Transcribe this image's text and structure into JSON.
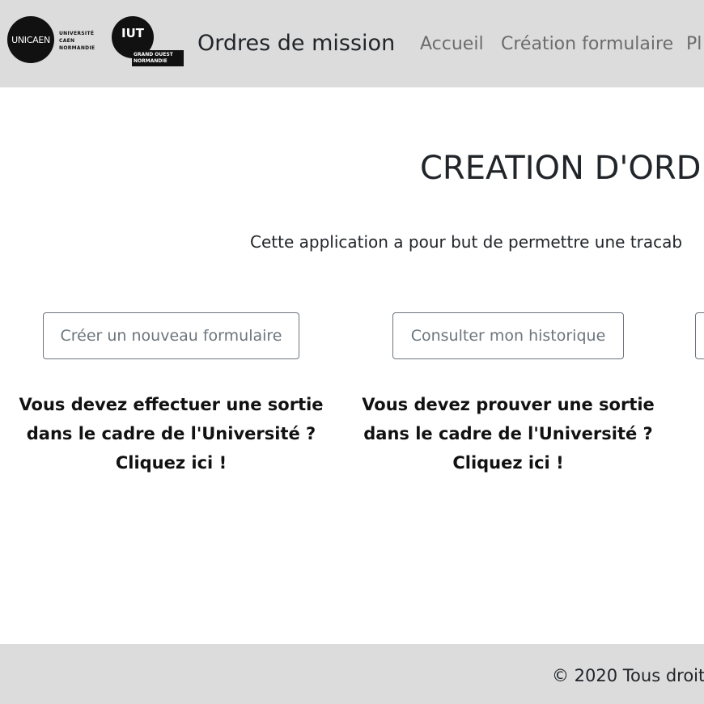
{
  "header": {
    "logos": {
      "unicaen_mark": "UNICAEN",
      "unicaen_text": [
        "UNIVERSITÉ",
        "CAEN",
        "NORMANDIE"
      ],
      "iut_mark": "IUT",
      "iut_text": [
        "GRAND OUEST",
        "NORMANDIE"
      ]
    },
    "brand": "Ordres de mission",
    "nav": [
      {
        "label": "Accueil"
      },
      {
        "label": "Création formulaire"
      },
      {
        "label": "Pl"
      }
    ]
  },
  "main": {
    "title": "CREATION D'ORDR",
    "intro": "Cette application a pour but de permettre une tracab",
    "cards": [
      {
        "button": "Créer un nouveau formulaire",
        "lines": [
          "Vous devez effectuer une sortie",
          "dans le cadre de l'Université ?",
          "Cliquez ici !"
        ]
      },
      {
        "button": "Consulter mon historique",
        "lines": [
          "Vous devez prouver une sortie",
          "dans le cadre de l'Université ?",
          "Cliquez ici !"
        ]
      },
      {
        "button": ""
      }
    ]
  },
  "footer": {
    "text": "© 2020 Tous droit"
  },
  "colors": {
    "navbar_bg": "#dcdcdc",
    "footer_bg": "#dcdcdc",
    "button_border": "#6c757d",
    "nav_link": "#6c6c6c"
  }
}
